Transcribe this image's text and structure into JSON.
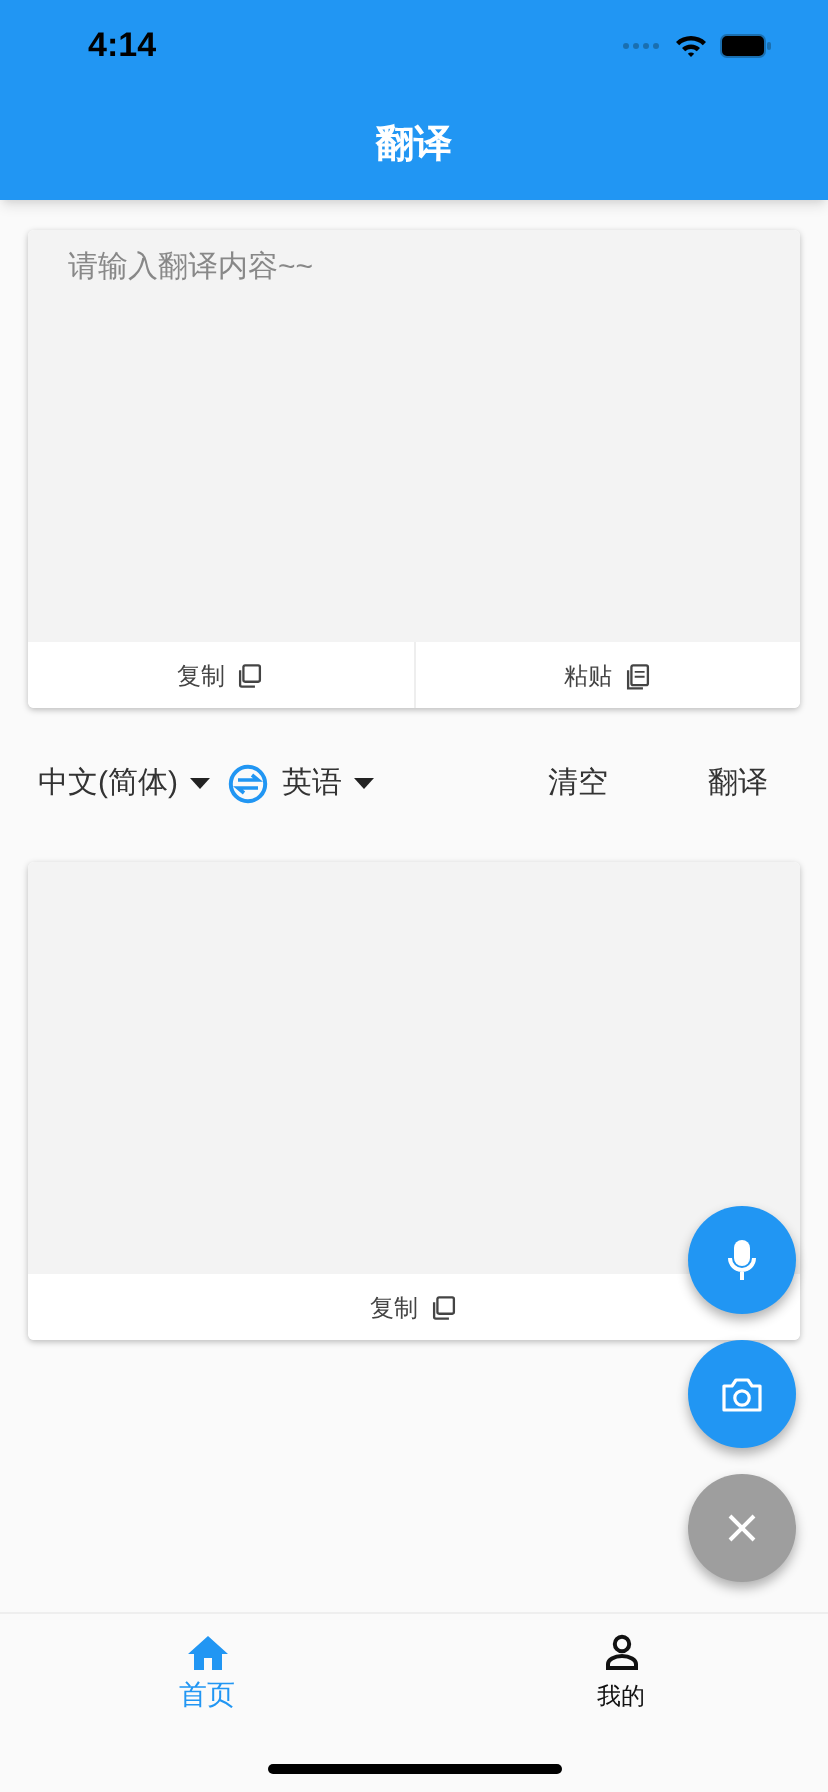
{
  "status_bar": {
    "time": "4:14"
  },
  "app_bar": {
    "title": "翻译"
  },
  "input_card": {
    "placeholder": "请输入翻译内容~~",
    "actions": [
      {
        "label": "复制",
        "kind": "copy"
      },
      {
        "label": "粘贴",
        "kind": "paste"
      }
    ]
  },
  "language_bar": {
    "source": "中文(简体)",
    "target": "英语",
    "buttons": [
      "清空",
      "翻译"
    ]
  },
  "output_card": {
    "actions": [
      {
        "label": "复制",
        "kind": "copy"
      }
    ]
  },
  "fabs": [
    {
      "kind": "mic"
    },
    {
      "kind": "camera"
    },
    {
      "kind": "close"
    }
  ],
  "bottom_nav": [
    {
      "label": "首页",
      "kind": "home",
      "selected": true
    },
    {
      "label": "我的",
      "kind": "person",
      "selected": false
    }
  ]
}
